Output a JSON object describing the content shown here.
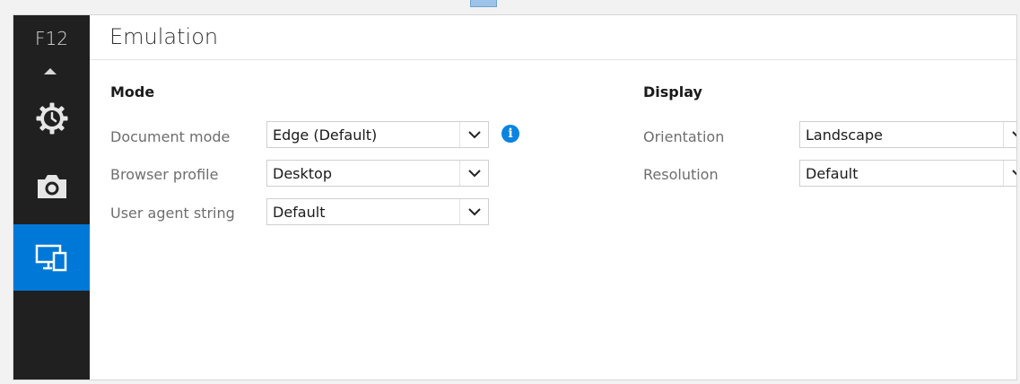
{
  "sidebar": {
    "title": "F12",
    "items": [
      {
        "name": "performance",
        "icon": "clock-gear-icon",
        "selected": false
      },
      {
        "name": "memory",
        "icon": "camera-icon",
        "selected": false
      },
      {
        "name": "emulation",
        "icon": "devices-icon",
        "selected": true
      }
    ]
  },
  "page": {
    "title": "Emulation"
  },
  "mode": {
    "heading": "Mode",
    "document_mode": {
      "label": "Document mode",
      "value": "Edge (Default)"
    },
    "browser_profile": {
      "label": "Browser profile",
      "value": "Desktop"
    },
    "user_agent": {
      "label": "User agent string",
      "value": "Default"
    },
    "info_icon": "i"
  },
  "display": {
    "heading": "Display",
    "orientation": {
      "label": "Orientation",
      "value": "Landscape"
    },
    "resolution": {
      "label": "Resolution",
      "value": "Default"
    }
  },
  "colors": {
    "sidebar_bg": "#202020",
    "accent": "#0078d7",
    "info": "#0a84e0"
  }
}
